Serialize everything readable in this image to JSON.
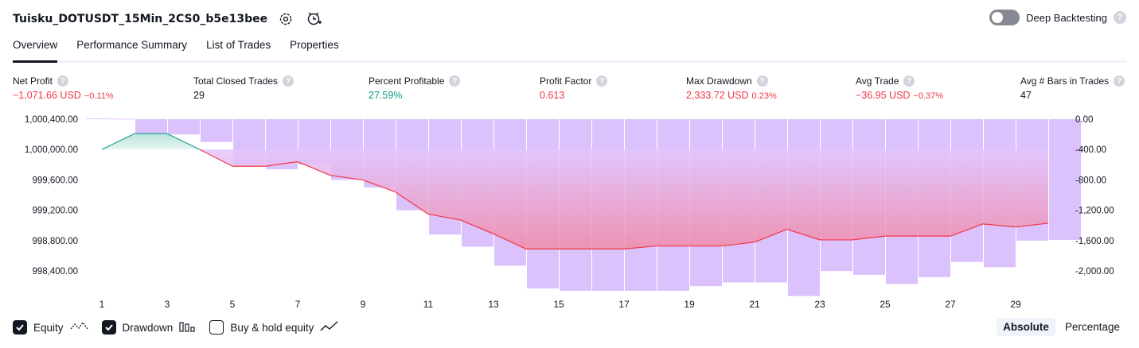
{
  "header": {
    "strategy_name": "Tuisku_DOTUSDT_15Min_2CS0_b5e13bee",
    "deep_backtesting_label": "Deep Backtesting",
    "help_glyph": "?"
  },
  "tabs": [
    {
      "label": "Overview",
      "active": true
    },
    {
      "label": "Performance Summary",
      "active": false
    },
    {
      "label": "List of Trades",
      "active": false
    },
    {
      "label": "Properties",
      "active": false
    }
  ],
  "stats": [
    {
      "label": "Net Profit",
      "value": "−1,071.66 USD",
      "sub": "−0.11%",
      "tone": "neg"
    },
    {
      "label": "Total Closed Trades",
      "value": "29",
      "sub": "",
      "tone": ""
    },
    {
      "label": "Percent Profitable",
      "value": "27.59%",
      "sub": "",
      "tone": "pos"
    },
    {
      "label": "Profit Factor",
      "value": "0.613",
      "sub": "",
      "tone": "neg"
    },
    {
      "label": "Max Drawdown",
      "value": "2,333.72 USD",
      "sub": "0.23%",
      "tone": "neg"
    },
    {
      "label": "Avg Trade",
      "value": "−36.95 USD",
      "sub": "−0.37%",
      "tone": "neg"
    },
    {
      "label": "Avg # Bars in Trades",
      "value": "47",
      "sub": "",
      "tone": ""
    }
  ],
  "legend": {
    "equity_label": "Equity",
    "drawdown_label": "Drawdown",
    "buyhold_label": "Buy & hold equity"
  },
  "modes": {
    "absolute_label": "Absolute",
    "percentage_label": "Percentage"
  },
  "colors": {
    "loss": "#f23645",
    "profit": "#089981",
    "drawdown": "#e1c4fc",
    "equity_line": "#f23645"
  },
  "chart_data": {
    "type": "line",
    "x_ticks": [
      "1",
      "3",
      "5",
      "7",
      "9",
      "11",
      "13",
      "15",
      "17",
      "19",
      "21",
      "23",
      "25",
      "27",
      "29"
    ],
    "left_axis": {
      "ticks": [
        "1,000,400.00",
        "1,000,000.00",
        "999,600.00",
        "999,200.00",
        "998,800.00",
        "998,400.00"
      ],
      "ylim": [
        998150,
        1000400
      ]
    },
    "right_axis": {
      "ticks": [
        "0.00",
        "-400.00",
        "-800.00",
        "-1,200.00",
        "-1,600.00",
        "-2,000.00"
      ],
      "ylim": [
        -2250,
        0
      ]
    },
    "x": [
      1,
      2,
      3,
      4,
      5,
      6,
      7,
      8,
      9,
      10,
      11,
      12,
      13,
      14,
      15,
      16,
      17,
      18,
      19,
      20,
      21,
      22,
      23,
      24,
      25,
      26,
      27,
      28,
      29,
      30
    ],
    "series": [
      {
        "name": "Equity",
        "values": [
          1000000,
          1000210,
          1000210,
          1000000,
          999780,
          999780,
          999840,
          999660,
          999600,
          999440,
          999150,
          999070,
          998890,
          998690,
          998690,
          998690,
          998690,
          998730,
          998730,
          998730,
          998780,
          998950,
          998810,
          998810,
          998860,
          998860,
          998860,
          999020,
          998980,
          999030
        ]
      },
      {
        "name": "Drawdown",
        "values": [
          0,
          -200,
          -200,
          -300,
          -600,
          -660,
          -600,
          -800,
          -900,
          -1200,
          -1520,
          -1680,
          -1930,
          -2230,
          -2260,
          -2260,
          -2260,
          -2260,
          -2200,
          -2150,
          -2150,
          -2330,
          -2000,
          -2050,
          -2170,
          -2080,
          -1880,
          -1950,
          -1600,
          -1590
        ]
      }
    ]
  }
}
